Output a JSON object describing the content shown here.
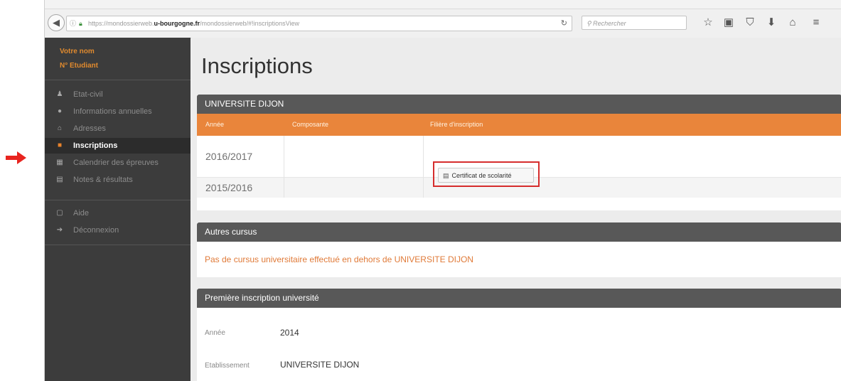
{
  "browser": {
    "url_prefix": "https://mondossierweb.",
    "url_domain": "u-bourgogne.fr",
    "url_path": "/mondossierweb/#!inscriptionsView",
    "search_placeholder": "Rechercher",
    "icons": [
      "back-icon",
      "info-icon",
      "lock-icon",
      "reload-icon",
      "search-icon",
      "star-icon",
      "clipboard-icon",
      "pocket-icon",
      "download-icon",
      "home-icon",
      "menu-icon"
    ]
  },
  "sidebar": {
    "user_name": "Votre nom",
    "student_number": "N° Etudiant",
    "items": [
      {
        "label": "Etat-civil",
        "icon": "user-icon",
        "active": false
      },
      {
        "label": "Informations annuelles",
        "icon": "info-circle-icon",
        "active": false
      },
      {
        "label": "Adresses",
        "icon": "home-icon",
        "active": false
      },
      {
        "label": "Inscriptions",
        "icon": "file-icon",
        "active": true
      },
      {
        "label": "Calendrier des épreuves",
        "icon": "calendar-icon",
        "active": false
      },
      {
        "label": "Notes & résultats",
        "icon": "list-icon",
        "active": false
      }
    ],
    "items2": [
      {
        "label": "Aide",
        "icon": "help-icon",
        "active": false
      },
      {
        "label": "Déconnexion",
        "icon": "logout-icon",
        "active": false
      }
    ]
  },
  "main": {
    "title": "Inscriptions",
    "university_panel": {
      "heading": "UNIVERSITE DIJON",
      "columns": [
        "Année",
        "Composante",
        "Filière d'inscription"
      ],
      "rows": [
        {
          "year": "2016/2017",
          "component": "",
          "program": "",
          "button": "Certificat de scolarité"
        },
        {
          "year": "2015/2016",
          "component": "",
          "program": ""
        }
      ]
    },
    "autres_panel": {
      "heading": "Autres cursus",
      "message": "Pas de cursus universitaire effectué en dehors de UNIVERSITE DIJON"
    },
    "premiere_panel": {
      "heading": "Première inscription université",
      "year_label": "Année",
      "year_value": "2014",
      "establishment_label": "Etablissement",
      "establishment_value": "UNIVERSITE DIJON"
    }
  },
  "colors": {
    "accent": "#e9853b",
    "sidebar": "#3c3c3c",
    "panel_header": "#585858",
    "highlight": "#d62d2d",
    "pointer": "#e8241f"
  }
}
